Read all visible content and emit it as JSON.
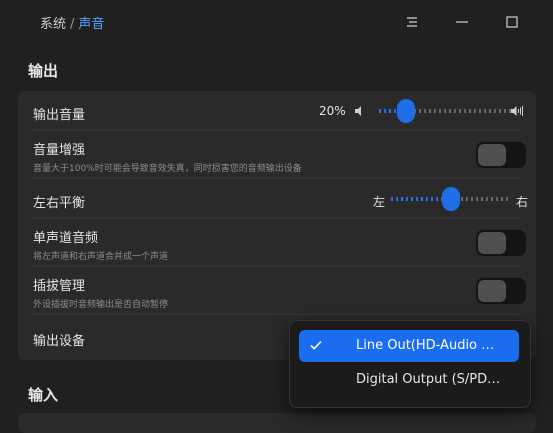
{
  "breadcrumb": {
    "root": "系统",
    "separator": "/",
    "current": "声音"
  },
  "output_section": {
    "title": "输出",
    "volume": {
      "label": "输出音量",
      "value_text": "20%",
      "level": 0.2
    },
    "boost": {
      "label": "音量增强",
      "description": "音量大于100%时可能会导致音效失真，同时损害您的音频输出设备",
      "enabled": false
    },
    "balance": {
      "label": "左右平衡",
      "left": "左",
      "right": "右",
      "level": 0.5
    },
    "mono": {
      "label": "单声道音频",
      "description": "将左声道和右声道合并成一个声道",
      "enabled": false
    },
    "plug": {
      "label": "插拔管理",
      "description": "外设插拔时音频输出是否自动暂停",
      "enabled": false
    },
    "device": {
      "label": "输出设备"
    }
  },
  "device_menu": {
    "options": [
      {
        "label": "Line Out(HD-Audio …",
        "selected": true
      },
      {
        "label": "Digital Output (S/PD…",
        "selected": false
      }
    ]
  },
  "input_section": {
    "title": "输入"
  },
  "colors": {
    "accent": "#1b6df0",
    "background": "#202020",
    "card": "#2a2a2a"
  }
}
